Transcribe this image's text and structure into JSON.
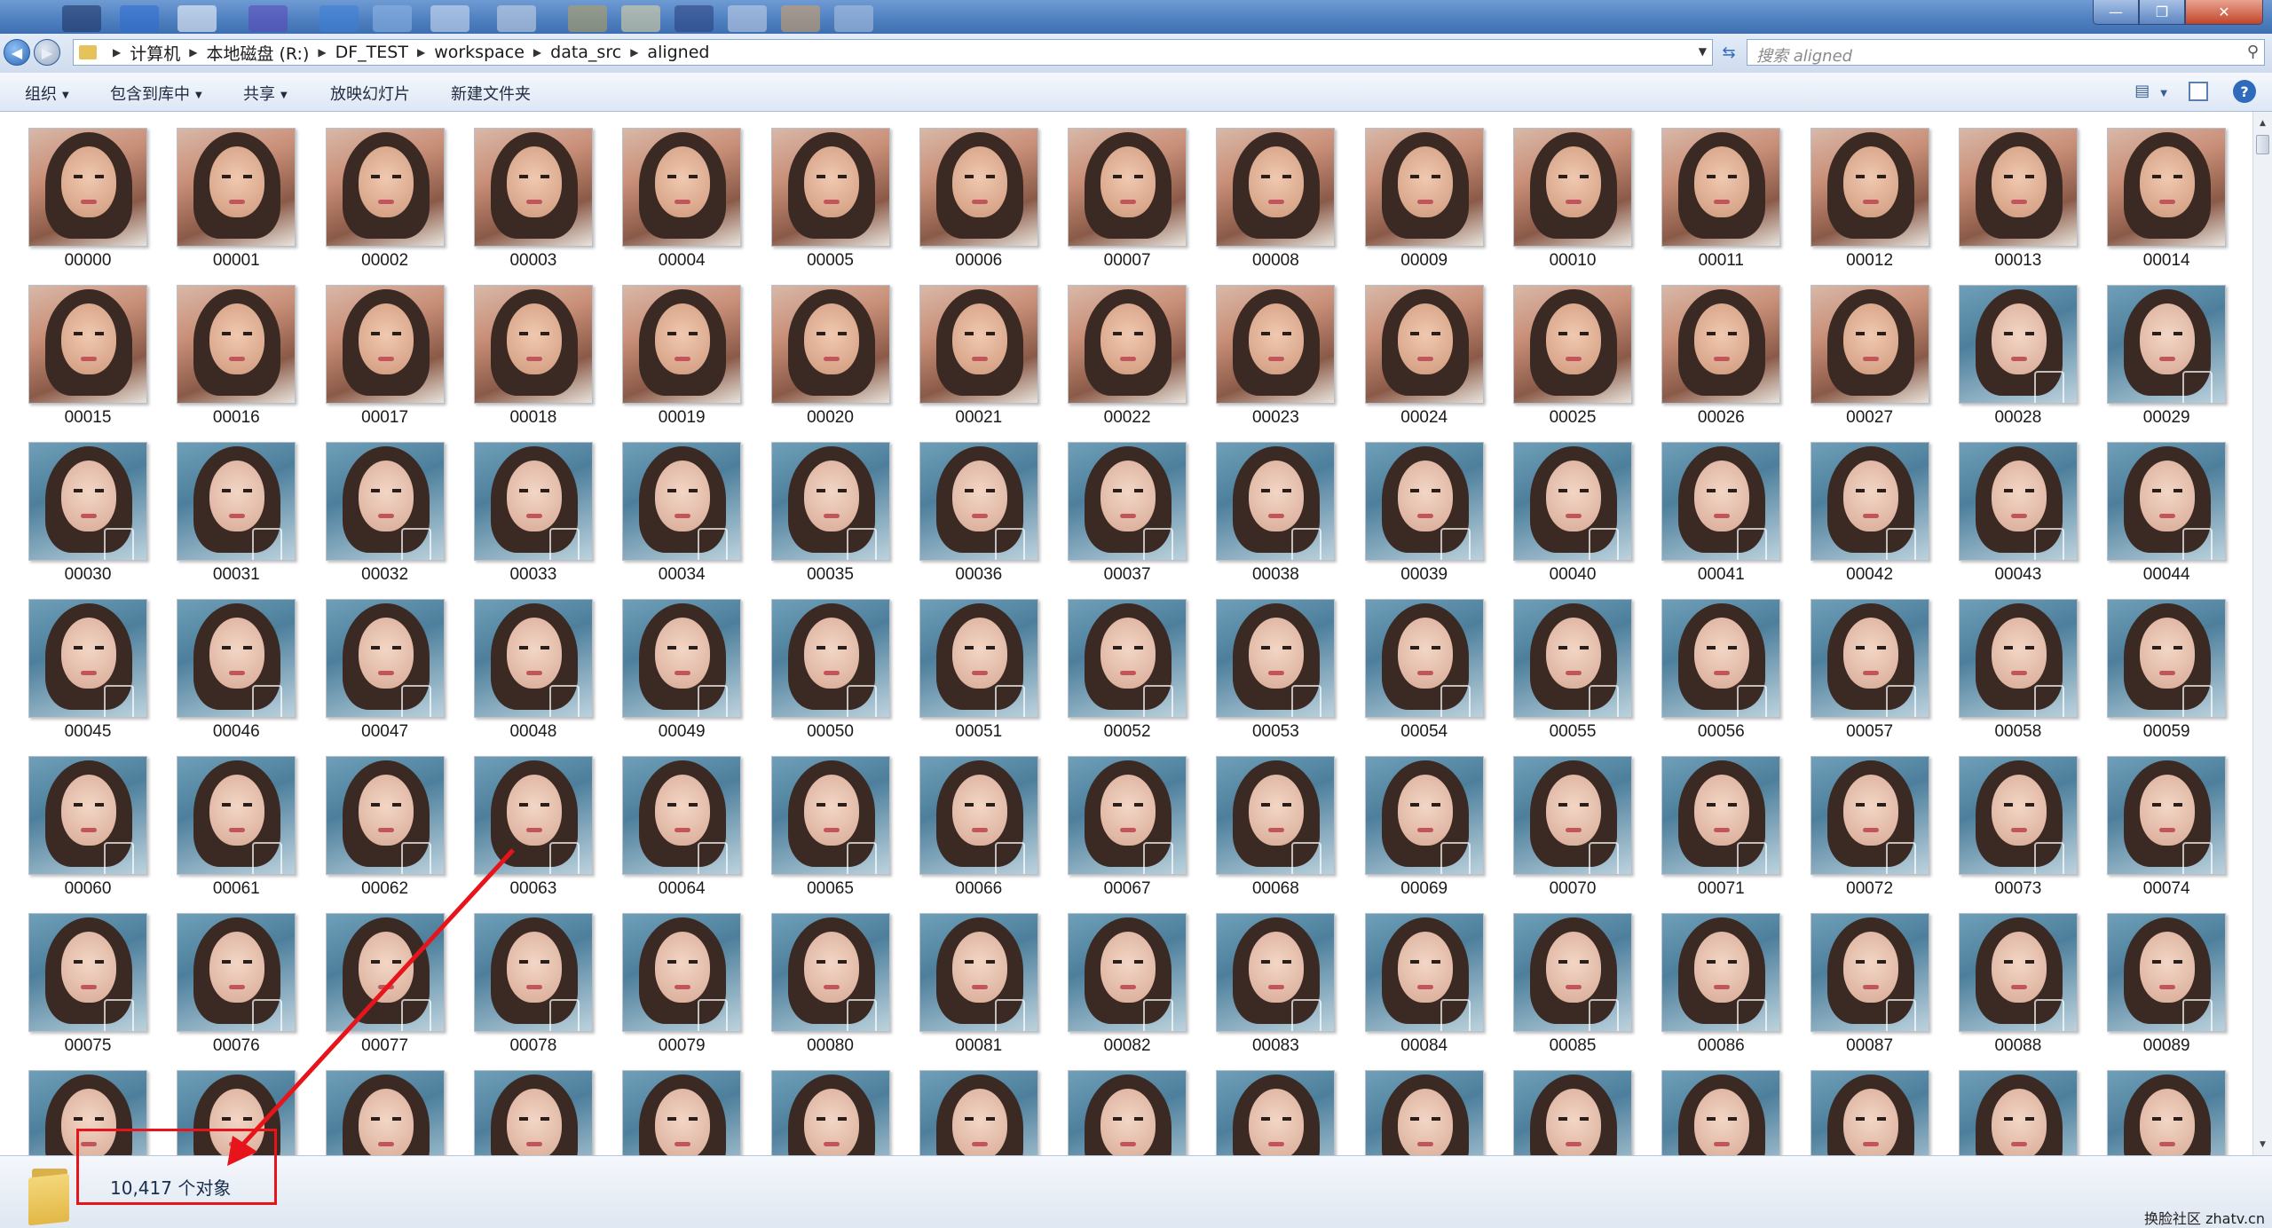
{
  "window": {
    "title_bar_icons": [
      "app-icon-1",
      "app-icon-2",
      "app-icon-3",
      "app-icon-4",
      "app-icon-5",
      "app-icon-6",
      "app-icon-7",
      "app-icon-8",
      "app-icon-9",
      "app-icon-10",
      "app-icon-11",
      "app-icon-12",
      "app-icon-13",
      "app-icon-14"
    ],
    "controls": {
      "minimize": "—",
      "maximize": "❐",
      "close": "✕"
    }
  },
  "address": {
    "breadcrumbs": [
      "计算机",
      "本地磁盘 (R:)",
      "DF_TEST",
      "workspace",
      "data_src",
      "aligned"
    ],
    "search_placeholder": "搜索 aligned"
  },
  "toolbar": {
    "organize": "组织",
    "include_in_library": "包含到库中",
    "share": "共享",
    "slideshow": "放映幻灯片",
    "new_folder": "新建文件夹",
    "help": "?"
  },
  "files": [
    "00000",
    "00001",
    "00002",
    "00003",
    "00004",
    "00005",
    "00006",
    "00007",
    "00008",
    "00009",
    "00010",
    "00011",
    "00012",
    "00013",
    "00014",
    "00015",
    "00016",
    "00017",
    "00018",
    "00019",
    "00020",
    "00021",
    "00022",
    "00023",
    "00024",
    "00025",
    "00026",
    "00027",
    "00028",
    "00029",
    "00030",
    "00031",
    "00032",
    "00033",
    "00034",
    "00035",
    "00036",
    "00037",
    "00038",
    "00039",
    "00040",
    "00041",
    "00042",
    "00043",
    "00044",
    "00045",
    "00046",
    "00047",
    "00048",
    "00049",
    "00050",
    "00051",
    "00052",
    "00053",
    "00054",
    "00055",
    "00056",
    "00057",
    "00058",
    "00059",
    "00060",
    "00061",
    "00062",
    "00063",
    "00064",
    "00065",
    "00066",
    "00067",
    "00068",
    "00069",
    "00070",
    "00071",
    "00072",
    "00073",
    "00074",
    "00075",
    "00076",
    "00077",
    "00078",
    "00079",
    "00080",
    "00081",
    "00082",
    "00083",
    "00084",
    "00085",
    "00086",
    "00087",
    "00088",
    "00089",
    "",
    "",
    "",
    "",
    "",
    "",
    "",
    "",
    "",
    "",
    "",
    "",
    "",
    "",
    ""
  ],
  "warm_count": 28,
  "status": {
    "item_count": "10,417 个对象"
  },
  "watermark": "换脸社区 zhatv.cn",
  "colors": {
    "annotation": "#e8141b",
    "titlebar": "#4e7fbf"
  }
}
